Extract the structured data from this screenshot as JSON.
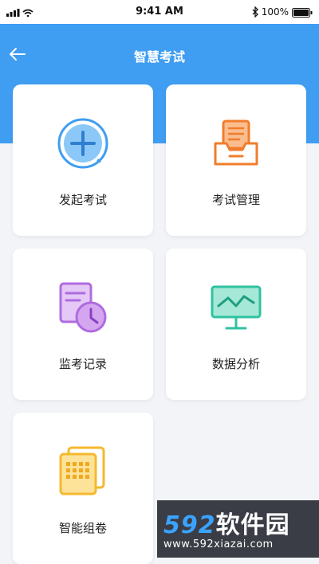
{
  "status": {
    "time": "9:41 AM",
    "battery": "100%"
  },
  "header": {
    "title": "智慧考试"
  },
  "menu": [
    {
      "label": "发起考试",
      "icon": "add-circle-icon",
      "color": "#3f9df2"
    },
    {
      "label": "考试管理",
      "icon": "inbox-tray-icon",
      "color": "#f07d2c"
    },
    {
      "label": "监考记录",
      "icon": "record-clock-icon",
      "color": "#b06be0"
    },
    {
      "label": "数据分析",
      "icon": "presentation-chart-icon",
      "color": "#2fc2a0"
    },
    {
      "label": "智能组卷",
      "icon": "paper-stack-icon",
      "color": "#f5b82e"
    }
  ],
  "watermark": {
    "logo_num": "592",
    "logo_text": "软件园",
    "url": "www.592xiazai.com"
  },
  "colors": {
    "accent": "#3f9df2",
    "background": "#f2f4f8"
  }
}
